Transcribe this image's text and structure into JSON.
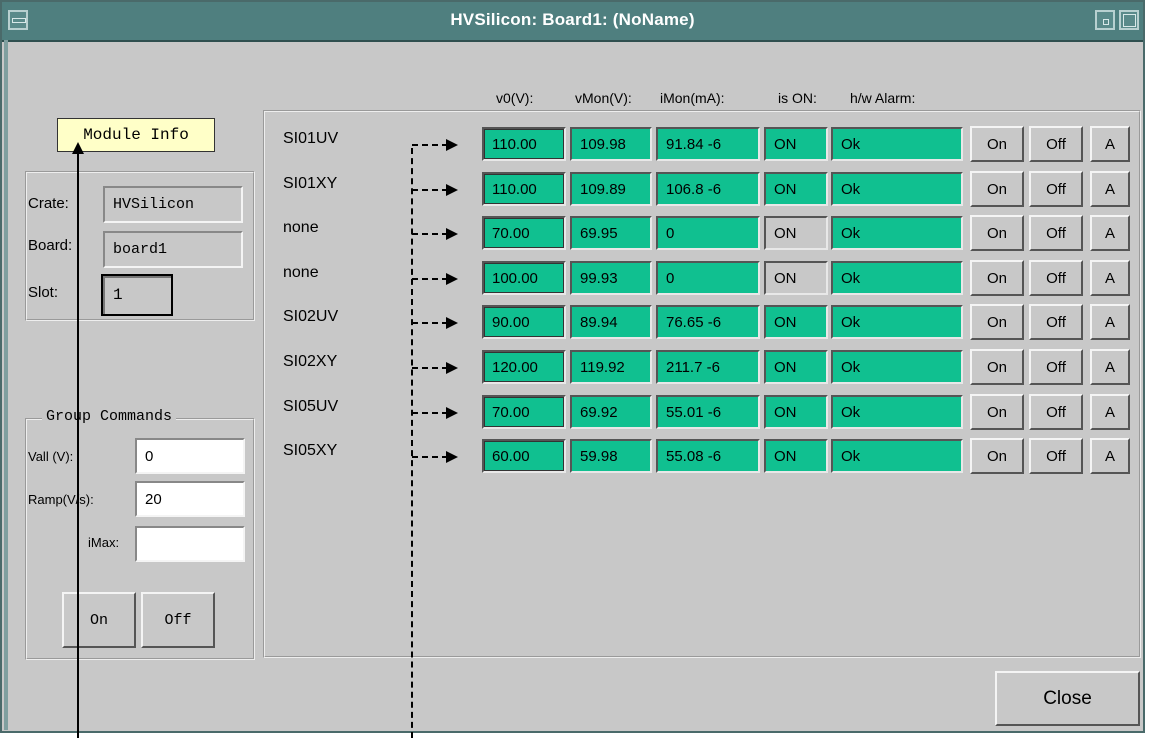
{
  "window": {
    "title": "HVSilicon: Board1: (NoName)"
  },
  "tooltip": {
    "text": "Module Info"
  },
  "info": {
    "crate_label": "Crate:",
    "crate_value": "HVSilicon",
    "board_label": "Board:",
    "board_value": "board1",
    "slot_label": "Slot:",
    "slot_value": "1"
  },
  "group": {
    "title": "Group Commands",
    "vall_label": "Vall (V):",
    "vall_value": "0",
    "ramp_label": "Ramp(V/s):",
    "ramp_value": "20",
    "imax_label": "iMax:",
    "imax_value": "",
    "on_label": "On",
    "off_label": "Off"
  },
  "columns": [
    "v0(V):",
    "vMon(V):",
    "iMon(mA):",
    "is ON:",
    "h/w Alarm:"
  ],
  "channels": [
    {
      "name": "SI01UV",
      "v0": "110.00",
      "vmon": "109.98",
      "imon": "91.84 -6",
      "ison": "ON",
      "alarm": "Ok",
      "on_state": true
    },
    {
      "name": "SI01XY",
      "v0": "110.00",
      "vmon": "109.89",
      "imon": "106.8 -6",
      "ison": "ON",
      "alarm": "Ok",
      "on_state": true
    },
    {
      "name": "none",
      "v0": "70.00",
      "vmon": "69.95",
      "imon": "0",
      "ison": "ON",
      "alarm": "Ok",
      "on_state": false
    },
    {
      "name": "none",
      "v0": "100.00",
      "vmon": "99.93",
      "imon": "0",
      "ison": "ON",
      "alarm": "Ok",
      "on_state": false
    },
    {
      "name": "SI02UV",
      "v0": "90.00",
      "vmon": "89.94",
      "imon": "76.65 -6",
      "ison": "ON",
      "alarm": "Ok",
      "on_state": true
    },
    {
      "name": "SI02XY",
      "v0": "120.00",
      "vmon": "119.92",
      "imon": "211.7 -6",
      "ison": "ON",
      "alarm": "Ok",
      "on_state": true
    },
    {
      "name": "SI05UV",
      "v0": "70.00",
      "vmon": "69.92",
      "imon": "55.01 -6",
      "ison": "ON",
      "alarm": "Ok",
      "on_state": true
    },
    {
      "name": "SI05XY",
      "v0": "60.00",
      "vmon": "59.98",
      "imon": "55.08 -6",
      "ison": "ON",
      "alarm": "Ok",
      "on_state": true
    }
  ],
  "row_buttons": {
    "on": "On",
    "off": "Off",
    "a": "A"
  },
  "close_label": "Close",
  "colors": {
    "green": "#10c090",
    "title_bar": "#4f7f7f",
    "bg": "#c8c8c8"
  }
}
